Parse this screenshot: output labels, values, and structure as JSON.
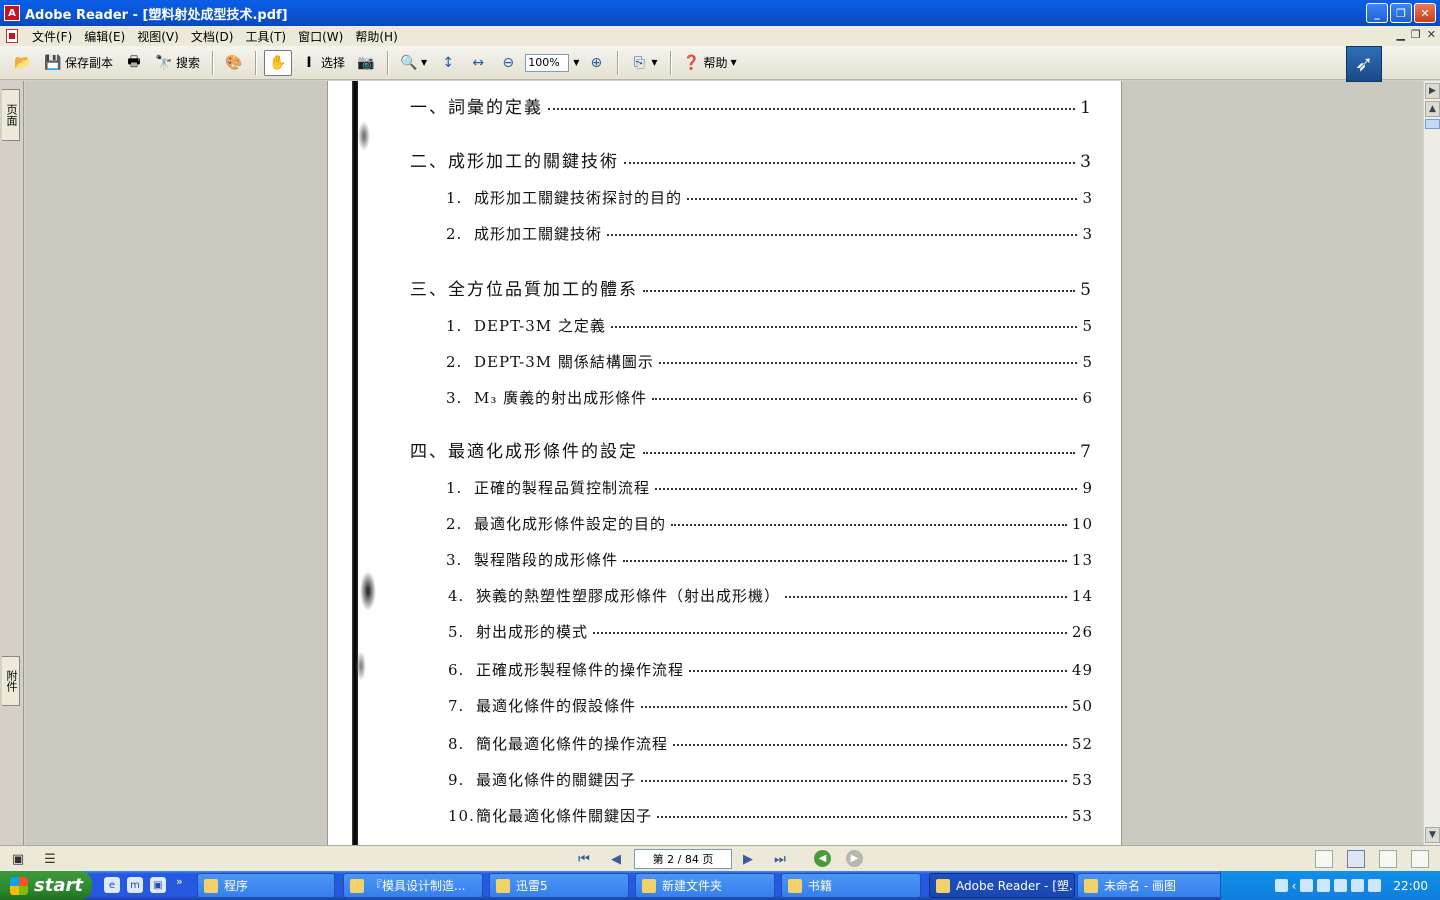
{
  "window": {
    "title": "Adobe Reader - [塑料射处成型技术.pdf]",
    "app_icon": "adobe-reader-icon"
  },
  "menu": {
    "items": [
      "文件(F)",
      "编辑(E)",
      "视图(V)",
      "文档(D)",
      "工具(T)",
      "窗口(W)",
      "帮助(H)"
    ]
  },
  "toolbar": {
    "save_copy": "保存副本",
    "search": "搜索",
    "select": "选择",
    "zoom_value": "100%",
    "help": "帮助"
  },
  "sidepanel": {
    "tab_pages": "页面",
    "tab_attachments": "附件"
  },
  "toc": [
    {
      "kind": "main",
      "num": "",
      "text": "一、詞彙的定義",
      "page": "1"
    },
    {
      "kind": "main",
      "num": "",
      "text": "二、成形加工的關鍵技術",
      "page": "3"
    },
    {
      "kind": "sub",
      "num": "1.",
      "text": "成形加工關鍵技術探討的目的",
      "page": "3"
    },
    {
      "kind": "sub",
      "num": "2.",
      "text": "成形加工關鍵技術",
      "page": "3"
    },
    {
      "kind": "main",
      "num": "",
      "text": "三、全方位品質加工的體系",
      "page": "5"
    },
    {
      "kind": "sub",
      "num": "1.",
      "text": "DEPT-3M 之定義",
      "page": "5"
    },
    {
      "kind": "sub",
      "num": "2.",
      "text": "DEPT-3M 關係結構圖示",
      "page": "5"
    },
    {
      "kind": "sub",
      "num": "3.",
      "text": "M₃ 廣義的射出成形條件",
      "page": "6"
    },
    {
      "kind": "main",
      "num": "",
      "text": "四、最適化成形條件的設定",
      "page": "7"
    },
    {
      "kind": "sub",
      "num": "1.",
      "text": "正確的製程品質控制流程",
      "page": "9"
    },
    {
      "kind": "sub",
      "num": "2.",
      "text": "最適化成形條件設定的目的",
      "page": "10"
    },
    {
      "kind": "sub",
      "num": "3.",
      "text": "製程階段的成形條件",
      "page": "13"
    },
    {
      "kind": "sub",
      "num": "4.",
      "text": "狹義的熱塑性塑膠成形條件（射出成形機）",
      "page": "14"
    },
    {
      "kind": "sub",
      "num": "5.",
      "text": "射出成形的模式",
      "page": "26"
    },
    {
      "kind": "sub",
      "num": "6.",
      "text": "正確成形製程條件的操作流程",
      "page": "49"
    },
    {
      "kind": "sub",
      "num": "7.",
      "text": "最適化條件的假設條件",
      "page": "50"
    },
    {
      "kind": "sub",
      "num": "8.",
      "text": "簡化最適化條件的操作流程",
      "page": "52"
    },
    {
      "kind": "sub",
      "num": "9.",
      "text": "最適化條件的關鍵因子",
      "page": "53"
    },
    {
      "kind": "sub",
      "num": "10.",
      "text": "簡化最適化條件關鍵因子",
      "page": "53"
    }
  ],
  "navigation": {
    "page_indicator": "第 2 / 84 页"
  },
  "taskbar": {
    "start_label": "start",
    "tasks": [
      {
        "label": "程序",
        "active": false
      },
      {
        "label": "『模具设计制造...",
        "active": false
      },
      {
        "label": "迅雷5",
        "active": false
      },
      {
        "label": "新建文件夹",
        "active": false
      },
      {
        "label": "书籍",
        "active": false
      },
      {
        "label": "Adobe Reader - [塑...",
        "active": true
      },
      {
        "label": "未命名 - 画图",
        "active": false
      }
    ],
    "clock": "22:00"
  }
}
